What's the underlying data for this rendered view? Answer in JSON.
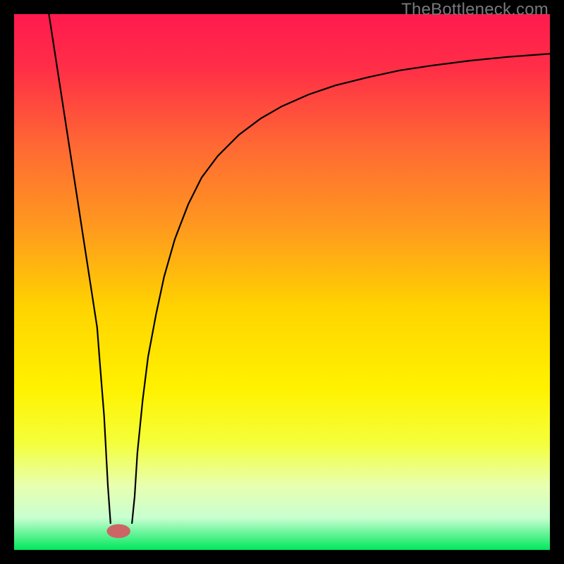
{
  "watermark": "TheBottleneck.com",
  "chart_data": {
    "type": "line",
    "title": "",
    "xlabel": "",
    "ylabel": "",
    "xlim": [
      0,
      100
    ],
    "ylim": [
      0,
      100
    ],
    "grid": false,
    "legend": false,
    "gradient_stops": [
      {
        "offset": 0.0,
        "color": "#ff1a4e"
      },
      {
        "offset": 0.1,
        "color": "#ff2e47"
      },
      {
        "offset": 0.25,
        "color": "#ff6a33"
      },
      {
        "offset": 0.4,
        "color": "#ff9a1e"
      },
      {
        "offset": 0.55,
        "color": "#ffd400"
      },
      {
        "offset": 0.7,
        "color": "#fff200"
      },
      {
        "offset": 0.8,
        "color": "#f4ff3a"
      },
      {
        "offset": 0.88,
        "color": "#e8ffb0"
      },
      {
        "offset": 0.94,
        "color": "#c8ffd0"
      },
      {
        "offset": 1.0,
        "color": "#00e85c"
      }
    ],
    "series": [
      {
        "name": "left-branch",
        "x": [
          6.5,
          7.5,
          8.5,
          9.5,
          10.5,
          11.5,
          12.5,
          13.5,
          14.5,
          15.5,
          16.0,
          16.8,
          17.5,
          18.0
        ],
        "y": [
          100,
          93.5,
          87.0,
          80.5,
          74.0,
          67.5,
          61.0,
          54.5,
          48.0,
          41.5,
          35.0,
          25.0,
          12.0,
          5.0
        ]
      },
      {
        "name": "right-branch",
        "x": [
          22.0,
          22.5,
          23.0,
          24.0,
          25.0,
          26.5,
          28.0,
          30.0,
          32.5,
          35.0,
          38.0,
          42.0,
          46.0,
          50.0,
          55.0,
          60.0,
          66.0,
          72.0,
          78.0,
          85.0,
          92.0,
          100.0
        ],
        "y": [
          5.0,
          10.0,
          18.0,
          28.0,
          36.0,
          44.0,
          51.0,
          58.0,
          64.5,
          69.5,
          73.5,
          77.5,
          80.5,
          82.8,
          85.0,
          86.7,
          88.2,
          89.5,
          90.4,
          91.3,
          92.0,
          92.6
        ]
      }
    ],
    "marker": {
      "name": "min-point-marker",
      "x": 19.5,
      "y": 3.5,
      "rx": 2.2,
      "ry": 1.3,
      "color": "#cc6666"
    }
  }
}
